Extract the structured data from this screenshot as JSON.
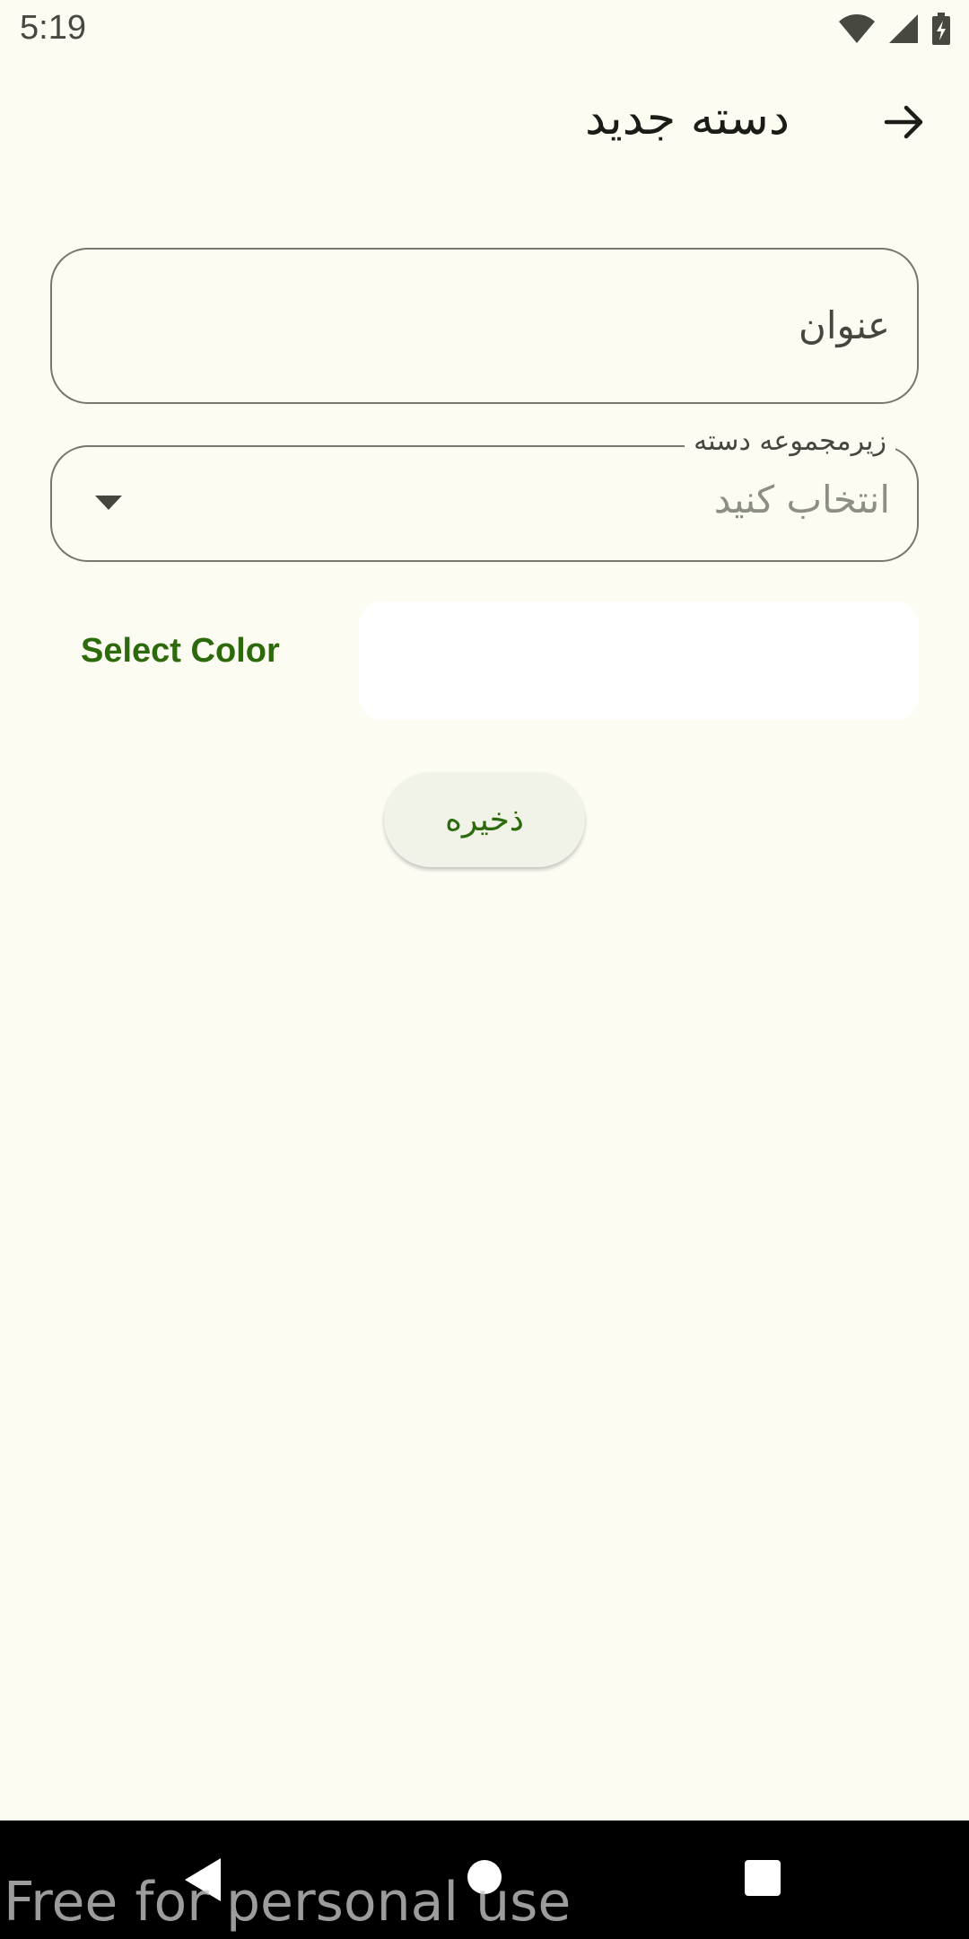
{
  "status_bar": {
    "time": "5:19",
    "icons": [
      "wifi-icon",
      "cellular-signal-icon",
      "battery-charging-icon"
    ]
  },
  "app_bar": {
    "title": "دسته جدید",
    "back_icon": "arrow-forward-icon"
  },
  "form": {
    "title_field": {
      "placeholder": "عنوان",
      "value": ""
    },
    "subcategory_field": {
      "label": "زیرمجموعه دسته",
      "placeholder": "انتخاب کنید",
      "icon": "dropdown-arrow-icon"
    },
    "color": {
      "label": "Select Color",
      "selected_color": "#ffffff"
    },
    "save_label": "ذخیره"
  },
  "nav_bar": {
    "icons": [
      "back-triangle-icon",
      "home-circle-icon",
      "recents-square-icon"
    ]
  },
  "watermark": "Free for personal use",
  "colors": {
    "background": "#fcfcf3",
    "accent": "#2c6a0b",
    "outline": "#77786d",
    "button_bg": "#f1f2e8"
  }
}
